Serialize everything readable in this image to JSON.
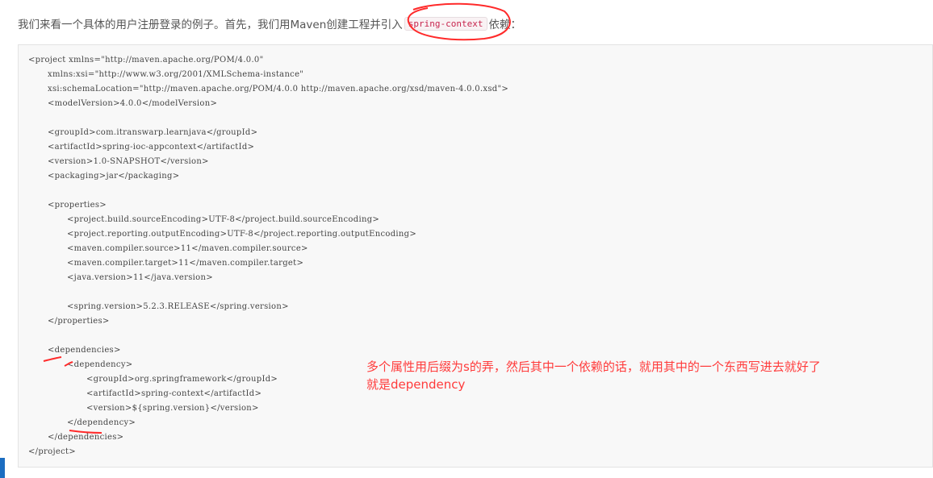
{
  "intro": {
    "text": "我们来看一个具体的用户注册登录的例子。首先，我们用Maven创建工程并引入",
    "code": "spring-context",
    "suffix": "依赖："
  },
  "code_lines": [
    {
      "indent": 0,
      "text": "<project xmlns=\"http://maven.apache.org/POM/4.0.0\""
    },
    {
      "indent": 1,
      "text": "xmlns:xsi=\"http://www.w3.org/2001/XMLSchema-instance\""
    },
    {
      "indent": 1,
      "text": "xsi:schemaLocation=\"http://maven.apache.org/POM/4.0.0 http://maven.apache.org/xsd/maven-4.0.0.xsd\">"
    },
    {
      "indent": 1,
      "text": "<modelVersion>4.0.0</modelVersion>"
    },
    {
      "indent": 0,
      "text": ""
    },
    {
      "indent": 1,
      "text": "<groupId>com.itranswarp.learnjava</groupId>"
    },
    {
      "indent": 1,
      "text": "<artifactId>spring-ioc-appcontext</artifactId>"
    },
    {
      "indent": 1,
      "text": "<version>1.0-SNAPSHOT</version>"
    },
    {
      "indent": 1,
      "text": "<packaging>jar</packaging>"
    },
    {
      "indent": 0,
      "text": ""
    },
    {
      "indent": 1,
      "text": "<properties>"
    },
    {
      "indent": 2,
      "text": "<project.build.sourceEncoding>UTF-8</project.build.sourceEncoding>"
    },
    {
      "indent": 2,
      "text": "<project.reporting.outputEncoding>UTF-8</project.reporting.outputEncoding>"
    },
    {
      "indent": 2,
      "text": "<maven.compiler.source>11</maven.compiler.source>"
    },
    {
      "indent": 2,
      "text": "<maven.compiler.target>11</maven.compiler.target>"
    },
    {
      "indent": 2,
      "text": "<java.version>11</java.version>"
    },
    {
      "indent": 0,
      "text": ""
    },
    {
      "indent": 2,
      "text": "<spring.version>5.2.3.RELEASE</spring.version>"
    },
    {
      "indent": 1,
      "text": "</properties>"
    },
    {
      "indent": 0,
      "text": ""
    },
    {
      "indent": 1,
      "text": "<dependencies>"
    },
    {
      "indent": 2,
      "text": "<dependency>"
    },
    {
      "indent": 3,
      "text": "<groupId>org.springframework</groupId>"
    },
    {
      "indent": 3,
      "text": "<artifactId>spring-context</artifactId>"
    },
    {
      "indent": 3,
      "text": "<version>${spring.version}</version>"
    },
    {
      "indent": 2,
      "text": "</dependency>"
    },
    {
      "indent": 1,
      "text": "</dependencies>"
    },
    {
      "indent": 0,
      "text": "</project>"
    }
  ],
  "annotation": {
    "line1": "多个属性用后缀为s的弄，然后其中一个依赖的话，就用其中的一个东西写进去就好了",
    "line2": "就是dependency"
  },
  "colors": {
    "annotation_red": "#ff3b3b",
    "inline_code": "#c7254e",
    "accent_bar": "#1b6dc1"
  }
}
